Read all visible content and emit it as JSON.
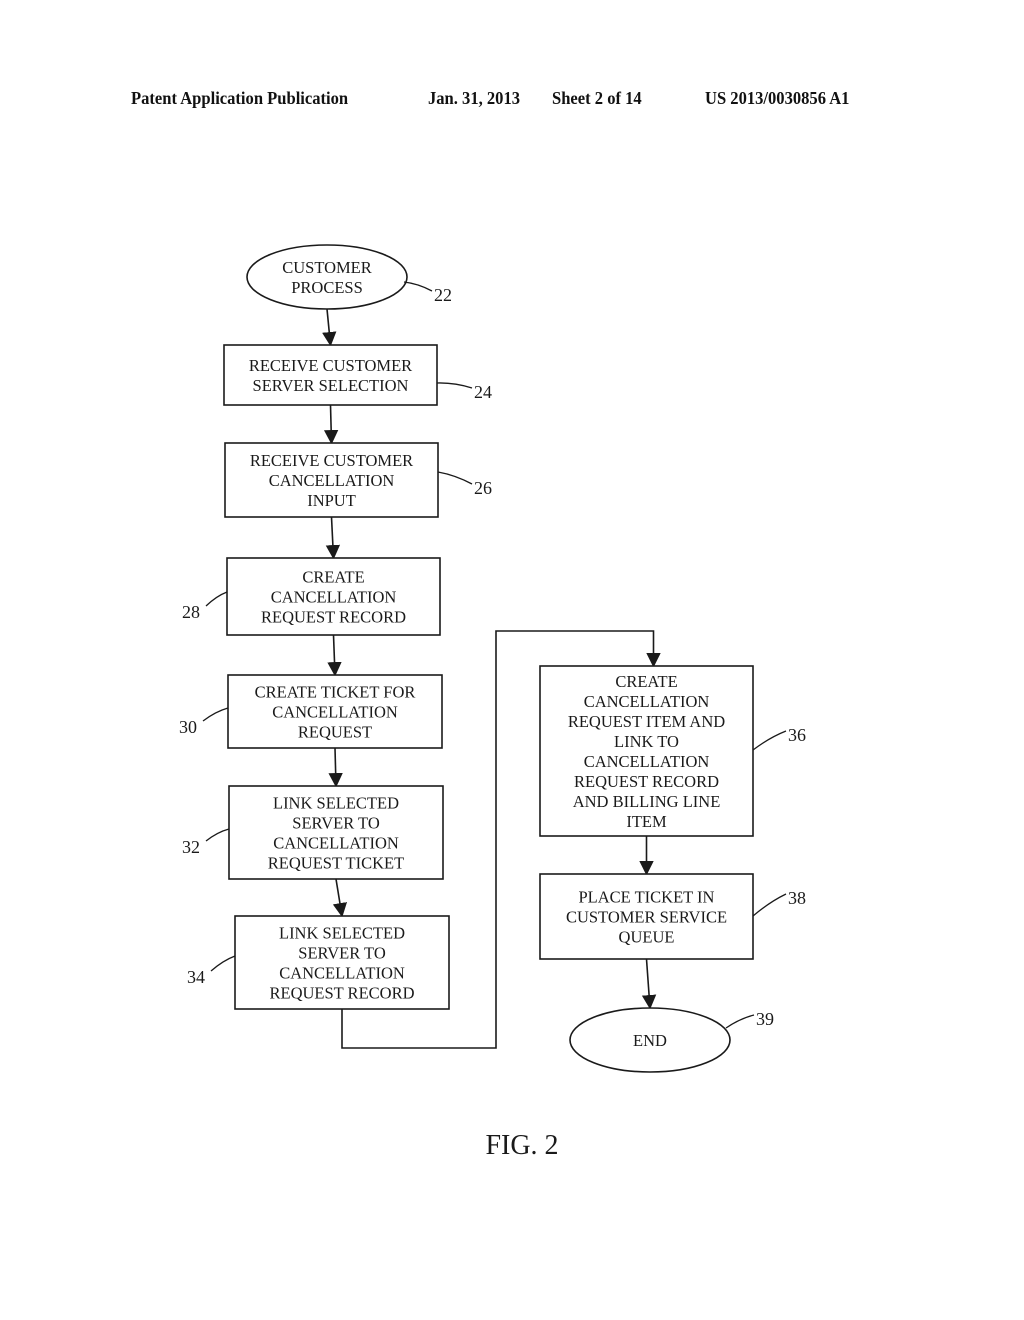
{
  "header": {
    "publication": "Patent Application Publication",
    "date": "Jan. 31, 2013",
    "sheet": "Sheet 2 of 14",
    "number": "US 2013/0030856 A1"
  },
  "figure_label": "FIG. 2",
  "flowchart": {
    "nodes": [
      {
        "id": "22",
        "shape": "ellipse",
        "lines": [
          "CUSTOMER",
          "PROCESS"
        ]
      },
      {
        "id": "24",
        "shape": "rect",
        "lines": [
          "RECEIVE CUSTOMER",
          "SERVER SELECTION"
        ]
      },
      {
        "id": "26",
        "shape": "rect",
        "lines": [
          "RECEIVE CUSTOMER",
          "CANCELLATION",
          "INPUT"
        ]
      },
      {
        "id": "28",
        "shape": "rect",
        "lines": [
          "CREATE",
          "CANCELLATION",
          "REQUEST RECORD"
        ]
      },
      {
        "id": "30",
        "shape": "rect",
        "lines": [
          "CREATE TICKET FOR",
          "CANCELLATION",
          "REQUEST"
        ]
      },
      {
        "id": "32",
        "shape": "rect",
        "lines": [
          "LINK SELECTED",
          "SERVER TO",
          "CANCELLATION",
          "REQUEST TICKET"
        ]
      },
      {
        "id": "34",
        "shape": "rect",
        "lines": [
          "LINK SELECTED",
          "SERVER TO",
          "CANCELLATION",
          "REQUEST RECORD"
        ]
      },
      {
        "id": "36",
        "shape": "rect",
        "lines": [
          "CREATE",
          "CANCELLATION",
          "REQUEST ITEM AND",
          "LINK TO",
          "CANCELLATION",
          "REQUEST RECORD",
          "AND BILLING LINE",
          "ITEM"
        ]
      },
      {
        "id": "38",
        "shape": "rect",
        "lines": [
          "PLACE TICKET IN",
          "CUSTOMER SERVICE",
          "QUEUE"
        ]
      },
      {
        "id": "39",
        "shape": "ellipse",
        "lines": [
          "END"
        ]
      }
    ],
    "edges": [
      [
        "22",
        "24"
      ],
      [
        "24",
        "26"
      ],
      [
        "26",
        "28"
      ],
      [
        "28",
        "30"
      ],
      [
        "30",
        "32"
      ],
      [
        "32",
        "34"
      ],
      [
        "34",
        "36"
      ],
      [
        "36",
        "38"
      ],
      [
        "38",
        "39"
      ]
    ]
  }
}
